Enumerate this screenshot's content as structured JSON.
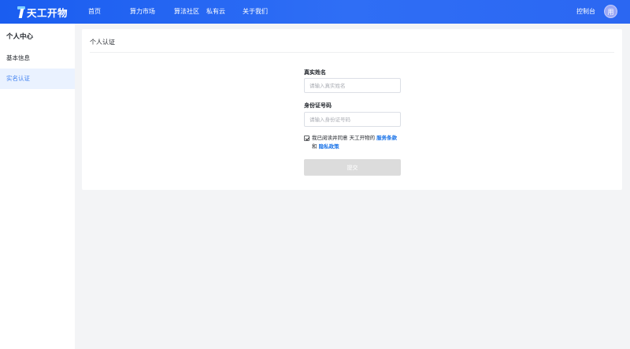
{
  "header": {
    "logo_text": "天工开物",
    "nav": [
      {
        "label": "首页"
      },
      {
        "label": "算力市场"
      },
      {
        "label": "算法社区"
      },
      {
        "label": "私有云"
      },
      {
        "label": "关于我们"
      }
    ],
    "console_label": "控制台",
    "avatar_text": "用"
  },
  "sidebar": {
    "title": "个人中心",
    "items": [
      {
        "label": "基本信息",
        "active": false
      },
      {
        "label": "实名认证",
        "active": true
      }
    ]
  },
  "main": {
    "title": "个人认证",
    "form": {
      "name_label": "真实姓名",
      "name_placeholder": "请输入真实姓名",
      "name_value": "",
      "id_label": "身份证号码",
      "id_placeholder": "请输入身份证号码",
      "id_value": "",
      "agreement_text": "我已阅读并同意 天工开物的",
      "terms_link": "服务条款",
      "and_text": "和",
      "privacy_link": "隐私政策",
      "agreement_checked": true,
      "submit_label": "提交",
      "submit_disabled": true
    }
  },
  "colors": {
    "header_gradient_start": "#1a5df0",
    "header_gradient_end": "#2b67f2",
    "active_item_bg": "#eaf2ff",
    "active_item_text": "#3c7ef0",
    "link": "#1a73e8",
    "submit_disabled_bg": "#dcdcdc"
  }
}
